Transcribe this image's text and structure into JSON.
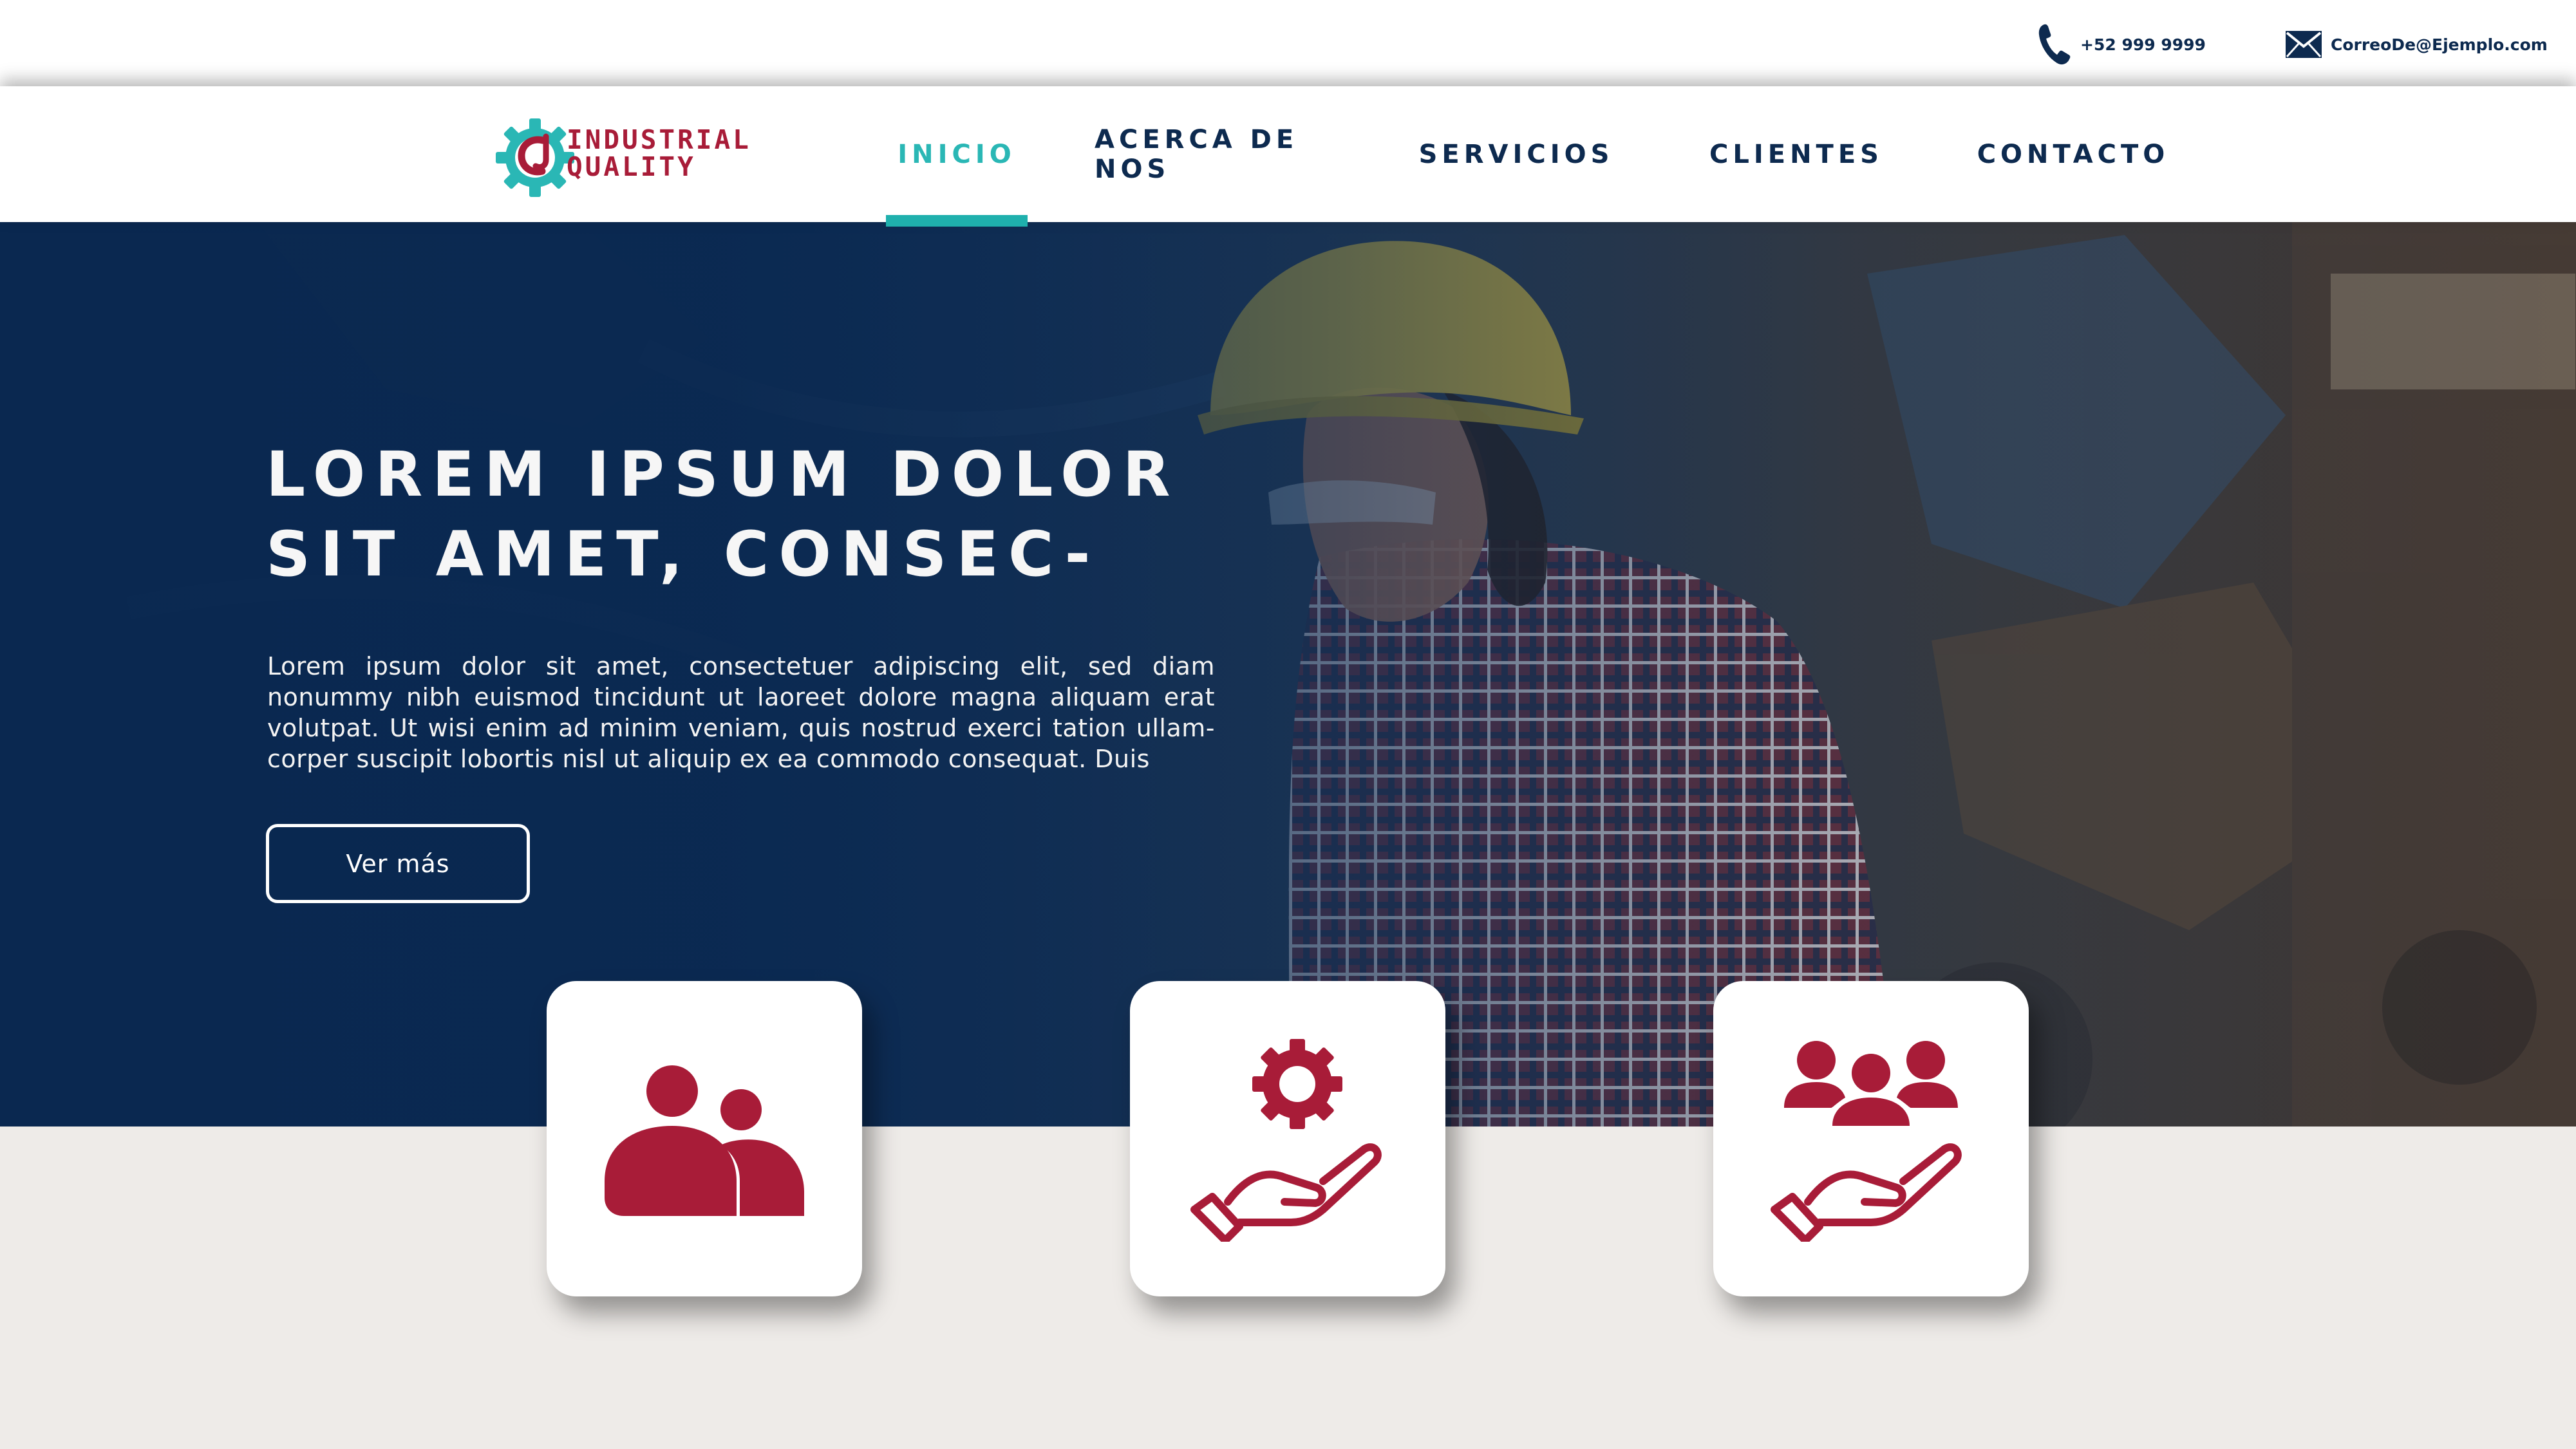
{
  "colors": {
    "navy": "#0d2a4f",
    "teal": "#2ab7b5",
    "crimson": "#a81c38",
    "light_bg": "#eeebe8"
  },
  "topbar": {
    "phone": {
      "icon": "phone-icon",
      "text": "+52 999 9999"
    },
    "email": {
      "icon": "envelope-icon",
      "text": "CorreoDe@Ejemplo.com"
    }
  },
  "logo": {
    "icon": "gear-logo-icon",
    "line1": "INDUSTRIAL",
    "line2": "QUALITY"
  },
  "nav": {
    "items": [
      {
        "label": "INICIO",
        "active": true
      },
      {
        "label": "ACERCA DE NOS",
        "active": false
      },
      {
        "label": "SERVICIOS",
        "active": false
      },
      {
        "label": "CLIENTES",
        "active": false
      },
      {
        "label": "CONTACTO",
        "active": false
      }
    ]
  },
  "hero": {
    "title_line1": "LOREM IPSUM DOLOR",
    "title_line2": "SIT AMET, CONSEC-",
    "body": "Lorem ipsum dolor sit amet, consectetuer adipiscing elit, sed diam nonummy nibh euismod tincidunt ut laoreet dolore magna aliquam erat volutpat. Ut wisi enim ad minim veniam, quis nostrud exerci tation ullam-corper suscipit lobortis nisl ut aliquip ex ea commodo consequat. Duis",
    "button_label": "Ver más"
  },
  "features": [
    {
      "icon": "users-icon"
    },
    {
      "icon": "hand-gear-icon"
    },
    {
      "icon": "hand-team-icon"
    }
  ]
}
